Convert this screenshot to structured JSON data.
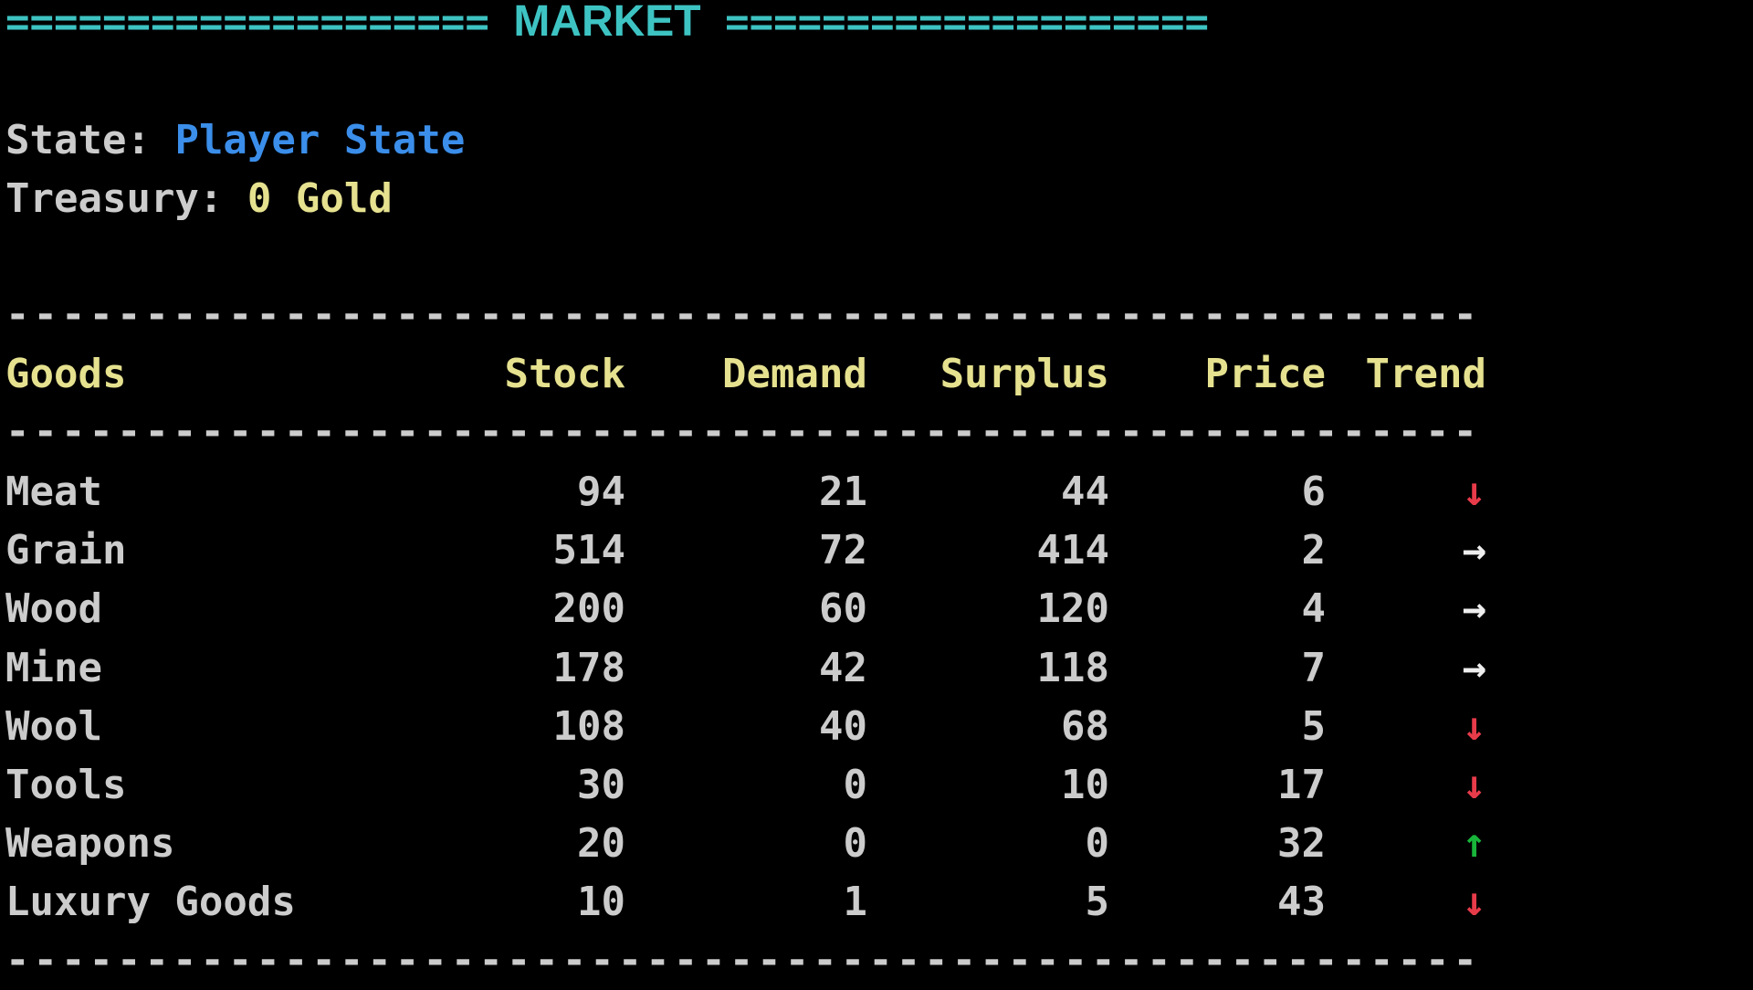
{
  "banner": {
    "left": "====================",
    "title": "MARKET",
    "right": "===================="
  },
  "state": {
    "label": "State:",
    "value": "Player State"
  },
  "treasury": {
    "label": "Treasury:",
    "value": "0 Gold"
  },
  "divider": "-----------------------------------------------------",
  "columns": {
    "goods": "Goods",
    "stock": "Stock",
    "demand": "Demand",
    "surplus": "Surplus",
    "price": "Price",
    "trend": "Trend"
  },
  "rows": [
    {
      "goods": "Meat",
      "stock": "94",
      "demand": "21",
      "surplus": "44",
      "price": "6",
      "trend": "↓",
      "trend_dir": "down"
    },
    {
      "goods": "Grain",
      "stock": "514",
      "demand": "72",
      "surplus": "414",
      "price": "2",
      "trend": "→",
      "trend_dir": "flat"
    },
    {
      "goods": "Wood",
      "stock": "200",
      "demand": "60",
      "surplus": "120",
      "price": "4",
      "trend": "→",
      "trend_dir": "flat"
    },
    {
      "goods": "Mine",
      "stock": "178",
      "demand": "42",
      "surplus": "118",
      "price": "7",
      "trend": "→",
      "trend_dir": "flat"
    },
    {
      "goods": "Wool",
      "stock": "108",
      "demand": "40",
      "surplus": "68",
      "price": "5",
      "trend": "↓",
      "trend_dir": "down"
    },
    {
      "goods": "Tools",
      "stock": "30",
      "demand": "0",
      "surplus": "10",
      "price": "17",
      "trend": "↓",
      "trend_dir": "down"
    },
    {
      "goods": "Weapons",
      "stock": "20",
      "demand": "0",
      "surplus": "0",
      "price": "32",
      "trend": "↑",
      "trend_dir": "up"
    },
    {
      "goods": "Luxury Goods",
      "stock": "10",
      "demand": "1",
      "surplus": "5",
      "price": "43",
      "trend": "↓",
      "trend_dir": "down"
    }
  ],
  "colors": {
    "banner": "#3ec3c3",
    "state_value": "#3b8eea",
    "treasury_value": "#e5e18f",
    "header": "#e5e18f",
    "trend_down": "#e83b4a",
    "trend_flat": "#eeeeee",
    "trend_up": "#18b53a"
  }
}
